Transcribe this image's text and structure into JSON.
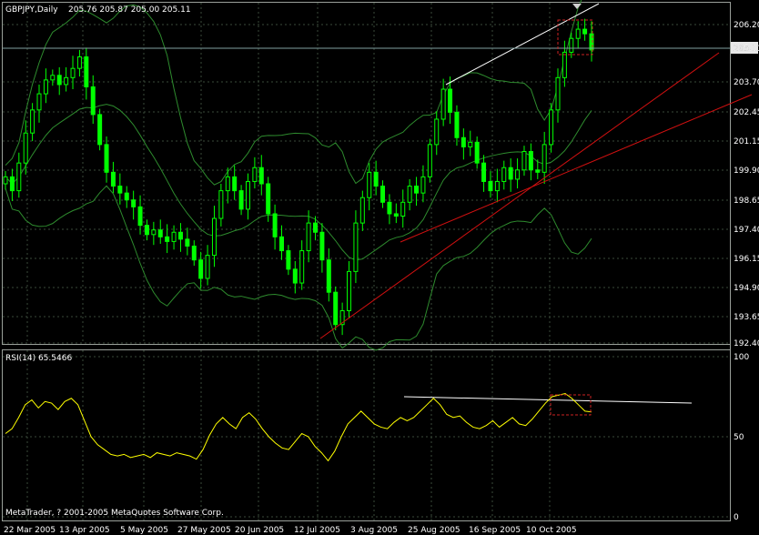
{
  "header": {
    "symbol_label": "GBPJPY,Daily",
    "ohlc_label": "205.76 205.87 205.00 205.11"
  },
  "rsi_header": {
    "label": "RSI(14) 65.5466"
  },
  "copyright": "MetaTrader, ? 2001-2005 MetaQuotes Software Corp.",
  "current_price_label": "205.11",
  "colors": {
    "candle": "#00ff00",
    "bands": "#2e8b2e",
    "rsi": "#ffff00",
    "trend_red": "#d01010",
    "trend_white": "#ffffff",
    "marker_box": "#cc2222"
  },
  "chart_data": [
    {
      "type": "candlestick",
      "title": "GBPJPY,Daily",
      "ylim": [
        192.4,
        206.2
      ],
      "y_ticks": [
        "206.20",
        "205.11",
        "203.70",
        "202.45",
        "201.15",
        "199.90",
        "198.65",
        "197.40",
        "196.15",
        "194.90",
        "193.65",
        "192.40"
      ],
      "x_ticks": [
        "22 Mar 2005",
        "13 Apr 2005",
        "5 May 2005",
        "27 May 2005",
        "20 Jun 2005",
        "12 Jul 2005",
        "3 Aug 2005",
        "25 Aug 2005",
        "16 Sep 2005",
        "10 Oct 2005"
      ],
      "close_series_approx": [
        199.6,
        199.0,
        200.2,
        201.5,
        202.5,
        203.2,
        203.8,
        204.0,
        203.6,
        203.9,
        204.3,
        204.8,
        203.5,
        202.3,
        201.0,
        199.8,
        199.2,
        198.9,
        198.6,
        198.3,
        197.5,
        197.1,
        197.3,
        197.0,
        196.8,
        197.2,
        196.9,
        196.6,
        196.0,
        195.2,
        196.2,
        197.8,
        199.0,
        199.6,
        199.0,
        198.2,
        199.4,
        200.0,
        199.3,
        198.0,
        197.0,
        196.4,
        195.6,
        195.0,
        196.4,
        197.6,
        197.2,
        196.0,
        194.6,
        193.2,
        193.8,
        195.5,
        197.6,
        198.7,
        199.8,
        199.2,
        198.5,
        198.0,
        197.9,
        198.5,
        199.2,
        198.9,
        199.6,
        201.0,
        202.1,
        203.4,
        202.4,
        201.3,
        200.9,
        201.1,
        200.2,
        199.4,
        199.0,
        199.4,
        200.0,
        199.5,
        199.9,
        200.7,
        199.9,
        199.8,
        201.0,
        202.5,
        203.9,
        205.0,
        205.6,
        206.0,
        205.8,
        205.1
      ],
      "bollinger": "upper, middle and lower bands shown",
      "trendlines": [
        "two red rising support lines",
        "white rising line across highs"
      ],
      "current_price": 205.11
    },
    {
      "type": "line",
      "title": "RSI(14) 65.5466",
      "ylim": [
        0,
        100
      ],
      "y_ticks": [
        "100",
        "50",
        "0"
      ],
      "value": 65.5466,
      "series_approx": [
        52,
        55,
        62,
        70,
        73,
        68,
        72,
        71,
        67,
        72,
        74,
        70,
        60,
        50,
        45,
        42,
        39,
        38,
        39,
        37,
        38,
        39,
        37,
        40,
        39,
        38,
        40,
        39,
        38,
        36,
        42,
        51,
        58,
        62,
        58,
        55,
        62,
        65,
        61,
        55,
        50,
        46,
        43,
        42,
        47,
        52,
        50,
        44,
        40,
        35,
        41,
        50,
        58,
        62,
        66,
        62,
        58,
        56,
        55,
        59,
        62,
        60,
        62,
        66,
        70,
        74,
        70,
        64,
        62,
        63,
        59,
        56,
        55,
        57,
        60,
        56,
        59,
        62,
        58,
        57,
        61,
        66,
        71,
        75,
        76,
        77,
        74,
        70,
        66,
        65.5
      ]
    }
  ]
}
